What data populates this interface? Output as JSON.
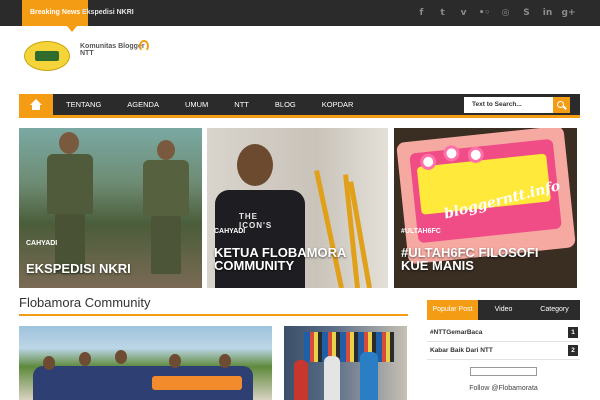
{
  "topbar": {
    "breaking_label": "Breaking News",
    "ticker_text": "Ekspedisi NKRI",
    "social_icons": [
      "facebook-icon",
      "twitter-icon",
      "vimeo-icon",
      "flickr-icon",
      "dribbble-icon",
      "skype-icon",
      "linkedin-icon",
      "google-plus-icon"
    ],
    "social_glyphs": [
      "f",
      "t",
      "v",
      "•◦",
      "◎",
      "S",
      "in",
      "g+"
    ]
  },
  "logo": {
    "text": "Komunitas Blogger NTT"
  },
  "nav": {
    "items": [
      "TENTANG",
      "AGENDA",
      "UMUM",
      "NTT",
      "BLOG",
      "KOPDAR"
    ],
    "search_placeholder": "Text to Search..."
  },
  "featured": [
    {
      "category": "CAHYADI",
      "title": "EKSPEDISI NKRI"
    },
    {
      "category": "CAHYADI",
      "title": "KETUA FLOBAMORA COMMUNITY"
    },
    {
      "category": "#ULTAH6FC",
      "title": "#ULTAH6FC FILOSOFI KUE MANIS"
    }
  ],
  "cake_text": "bloggerntt.info",
  "shirt_text": "THE ICON'S",
  "section": {
    "title": "Flobamora Community"
  },
  "sidebar": {
    "tabs": [
      "Popular Post",
      "Video",
      "Category"
    ],
    "items": [
      {
        "label": "#NTTGemarBaca",
        "num": "1"
      },
      {
        "label": "Kabar Baik Dari NTT",
        "num": "2"
      }
    ],
    "follow_text": "Follow @Flobamorata"
  },
  "colors": {
    "accent": "#f49c14",
    "dark": "#2b2b2b"
  }
}
